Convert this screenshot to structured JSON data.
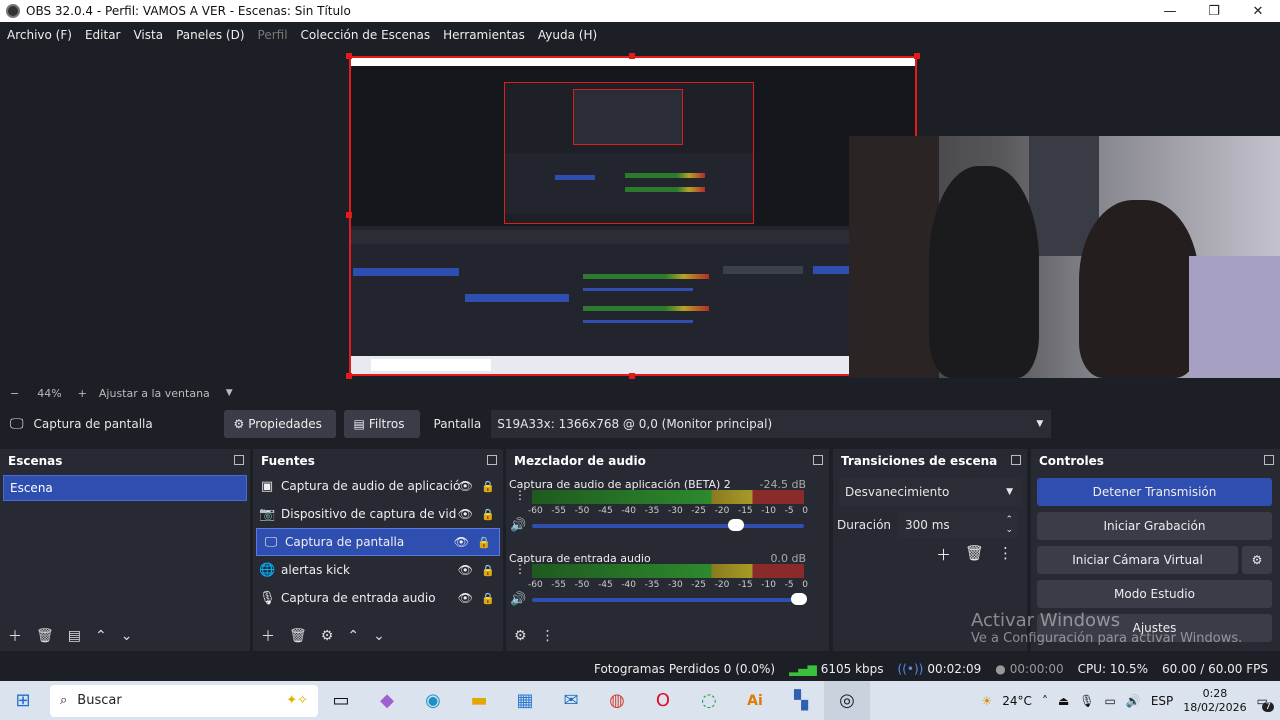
{
  "window": {
    "title": "OBS 32.0.4 - Perfil: VAMOS A VER - Escenas: Sin Título",
    "controls": {
      "minimize": "—",
      "maximize": "❐",
      "close": "✕"
    }
  },
  "menu": [
    "Archivo (F)",
    "Editar",
    "Vista",
    "Paneles (D)",
    "Perfil",
    "Colección de Escenas",
    "Herramientas",
    "Ayuda (H)"
  ],
  "zoom": {
    "minus": "−",
    "level": "44%",
    "plus": "+",
    "fit": "Ajustar a la ventana",
    "caret": "▼"
  },
  "source_toolbar": {
    "selected_source": "Captura de pantalla",
    "properties": "Propiedades",
    "filters": "Filtros",
    "display_label": "Pantalla",
    "display_value": "S19A33x: 1366x768 @ 0,0 (Monitor principal)"
  },
  "scenes": {
    "title": "Escenas",
    "items": [
      "Escena"
    ]
  },
  "sources": {
    "title": "Fuentes",
    "items": [
      {
        "label": "Captura de audio de aplicació",
        "icon": "app-audio-icon"
      },
      {
        "label": "Dispositivo de captura de vid",
        "icon": "camera-icon"
      },
      {
        "label": "Captura de pantalla",
        "icon": "monitor-icon"
      },
      {
        "label": "alertas kick",
        "icon": "globe-icon"
      },
      {
        "label": "Captura de entrada audio",
        "icon": "microphone-icon"
      }
    ]
  },
  "mixer": {
    "title": "Mezclador de audio",
    "channels": [
      {
        "name": "Captura de audio de aplicación (BETA) 2",
        "db": "-24.5 dB",
        "level": 0.75
      },
      {
        "name": "Captura de entrada audio",
        "db": "0.0 dB",
        "level": 0.98
      }
    ],
    "scale": [
      "-60",
      "-55",
      "-50",
      "-45",
      "-40",
      "-35",
      "-30",
      "-25",
      "-20",
      "-15",
      "-10",
      "-5",
      "0"
    ]
  },
  "transitions": {
    "title": "Transiciones de escena",
    "selected": "Desvanecimiento",
    "duration_label": "Duración",
    "duration_value": "300 ms"
  },
  "controls": {
    "title": "Controles",
    "stop_stream": "Detener Transmisión",
    "start_recording": "Iniciar Grabación",
    "start_virtual_cam": "Iniciar Cámara Virtual",
    "studio_mode": "Modo Estudio",
    "settings": "Ajustes"
  },
  "status": {
    "dropped_frames": "Fotogramas Perdidos 0 (0.0%)",
    "bitrate": "6105 kbps",
    "stream_time": "00:02:09",
    "record_time": "00:00:00",
    "cpu": "CPU: 10.5%",
    "fps": "60.00 / 60.00 FPS"
  },
  "watermark": {
    "line1": "Activar Windows",
    "line2": "Ve a Configuración para activar Windows."
  },
  "taskbar": {
    "search_placeholder": "Buscar",
    "weather": "24°C",
    "language": "ESP",
    "time": "0:28",
    "date": "18/02/2026",
    "notifications": "7"
  },
  "colors": {
    "accent": "#2f4fb0",
    "preview_border": "#e01c1c",
    "panel": "#272a33",
    "background": "#1d1f26"
  }
}
